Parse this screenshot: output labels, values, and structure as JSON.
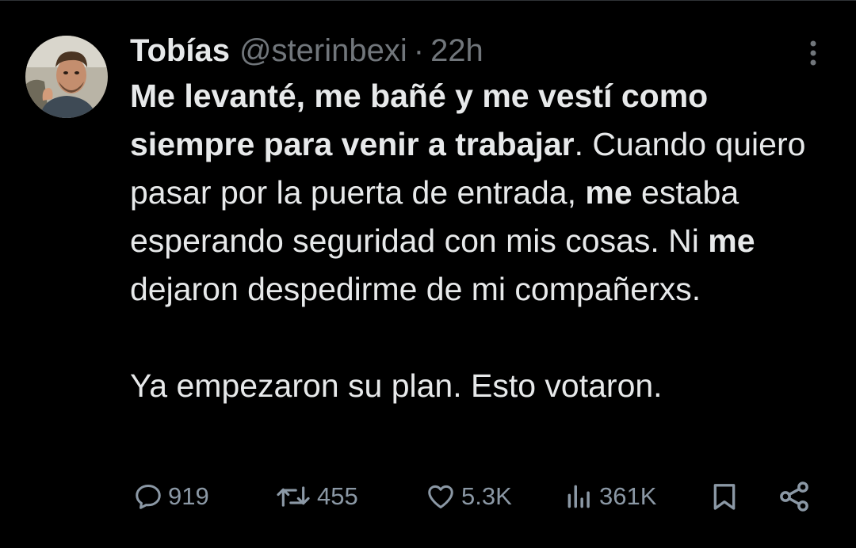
{
  "tweet": {
    "author": {
      "name": "Tobías",
      "handle": "@sterinbexi",
      "separator": "·",
      "time": "22h"
    },
    "text": {
      "p1_bold_1": "Me levanté, me bañé y me vestí como siempre para venir a trabajar",
      "p1_text_1": ". Cuando quiero pasar por la puerta de entrada, ",
      "p1_bold_2": "me",
      "p1_text_2": " estaba esperando seguridad con mis cosas. Ni ",
      "p1_bold_3": "me",
      "p1_text_3": " dejaron despedirme de mi compañerxs.",
      "p2": "Ya empezaron su plan. Esto votaron."
    },
    "metrics": {
      "replies": "919",
      "retweets": "455",
      "likes": "5.3K",
      "views": "361K"
    }
  },
  "icons": {
    "more": "more-vertical-icon",
    "reply": "reply-icon",
    "retweet": "retweet-icon",
    "like": "heart-icon",
    "views": "views-icon",
    "bookmark": "bookmark-icon",
    "share": "share-icon"
  },
  "colors": {
    "background": "#000000",
    "text_primary": "#e7e9ea",
    "text_secondary": "#71767b",
    "icon": "#8b98a5"
  }
}
